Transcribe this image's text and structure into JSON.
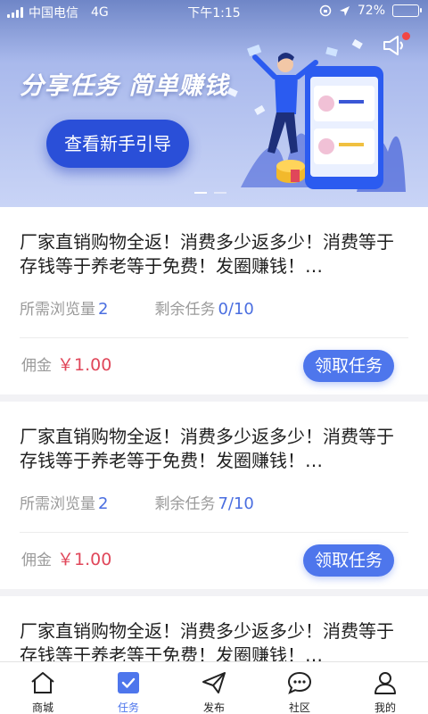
{
  "status_bar": {
    "carrier": "中国电信",
    "network": "4G",
    "time": "下午1:15",
    "battery_percent": "72%",
    "battery_level": 0.72
  },
  "banner": {
    "title": "分享任务  简单赚钱",
    "guide_button": "查看新手引导"
  },
  "tasks": [
    {
      "title": "厂家直销购物全返！消费多少返多少！消费等于存钱等于养老等于免费！发圈赚钱！…",
      "views_label": "所需浏览量",
      "views_value": "2",
      "remaining_label": "剩余任务",
      "remaining_value": "0/10",
      "commission_label": "佣金",
      "commission_value": "￥1.00",
      "claim_label": "领取任务"
    },
    {
      "title": "厂家直销购物全返！消费多少返多少！消费等于存钱等于养老等于免费！发圈赚钱！…",
      "views_label": "所需浏览量",
      "views_value": "2",
      "remaining_label": "剩余任务",
      "remaining_value": "7/10",
      "commission_label": "佣金",
      "commission_value": "￥1.00",
      "claim_label": "领取任务"
    },
    {
      "title": "厂家直销购物全返！消费多少返多少！消费等于存钱等于养老等于免费！发圈赚钱！…"
    }
  ],
  "tabbar": {
    "items": [
      {
        "label": "商城",
        "icon": "home-icon"
      },
      {
        "label": "任务",
        "icon": "task-checkbox-icon",
        "active": true
      },
      {
        "label": "发布",
        "icon": "paper-plane-icon"
      },
      {
        "label": "社区",
        "icon": "chat-bubble-icon"
      },
      {
        "label": "我的",
        "icon": "user-icon"
      }
    ]
  },
  "colors": {
    "accent": "#4e76ec",
    "price": "#e0475a",
    "banner_button": "#2a4fd8"
  }
}
